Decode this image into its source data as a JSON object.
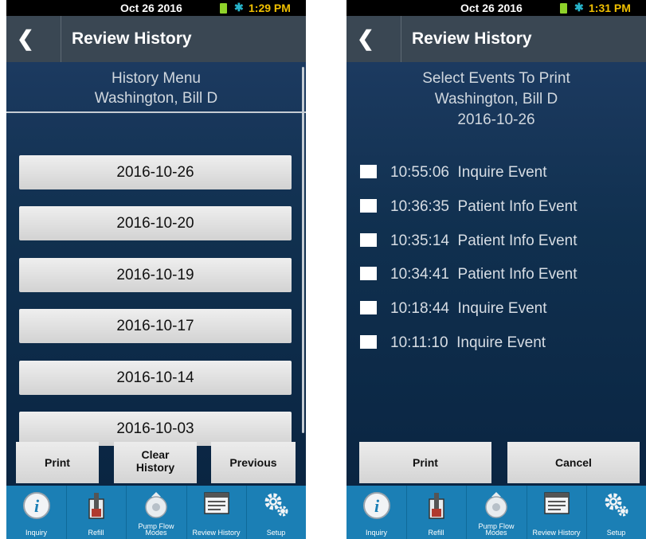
{
  "left": {
    "status": {
      "date": "Oct 26 2016",
      "time": "1:29 PM"
    },
    "header": {
      "back": "❮",
      "title": "Review History"
    },
    "menu": {
      "line1": "History Menu",
      "line2": "Washington, Bill D"
    },
    "dates": [
      "2016-10-26",
      "2016-10-20",
      "2016-10-19",
      "2016-10-17",
      "2016-10-14",
      "2016-10-03"
    ],
    "actions": {
      "print": "Print",
      "clear_line1": "Clear",
      "clear_line2": "History",
      "previous": "Previous"
    }
  },
  "right": {
    "status": {
      "date": "Oct 26 2016",
      "time": "1:31 PM"
    },
    "header": {
      "back": "❮",
      "title": "Review History"
    },
    "menu": {
      "line1": "Select Events To Print",
      "line2": "Washington, Bill D",
      "line3": "2016-10-26"
    },
    "events": [
      {
        "time": "10:55:06",
        "name": "Inquire Event"
      },
      {
        "time": "10:36:35",
        "name": "Patient Info Event"
      },
      {
        "time": "10:35:14",
        "name": "Patient Info Event"
      },
      {
        "time": "10:34:41",
        "name": "Patient Info Event"
      },
      {
        "time": "10:18:44",
        "name": "Inquire Event"
      },
      {
        "time": "10:11:10",
        "name": "Inquire Event"
      }
    ],
    "actions": {
      "print": "Print",
      "cancel": "Cancel"
    }
  },
  "tabs": {
    "inquiry": "Inquiry",
    "refill": "Refill",
    "pump_line1": "Pump Flow",
    "pump_line2": "Modes",
    "review": "Review History",
    "setup": "Setup"
  },
  "colors": {
    "tabbar": "#1b7fb5",
    "header": "#3a4753",
    "background": "#0c2845",
    "time": "#f0c000",
    "battery": "#8fd22a"
  },
  "icons": [
    "info-icon",
    "refill-icon",
    "pump-flow-icon",
    "review-history-icon",
    "setup-gear-icon",
    "bluetooth-icon",
    "battery-icon",
    "back-chevron-icon"
  ]
}
